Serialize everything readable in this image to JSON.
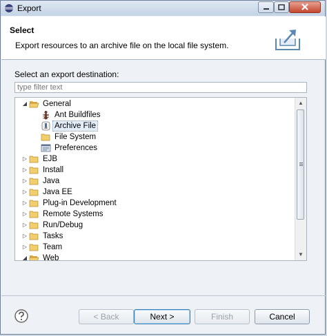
{
  "window": {
    "title": "Export"
  },
  "header": {
    "title": "Select",
    "description": "Export resources to an archive file on the local file system."
  },
  "destination": {
    "label": "Select an export destination:",
    "filter_placeholder": "type filter text"
  },
  "tree": {
    "general": "General",
    "ant_buildfiles": "Ant Buildfiles",
    "archive_file": "Archive File",
    "file_system": "File System",
    "preferences": "Preferences",
    "ejb": "EJB",
    "install": "Install",
    "java": "Java",
    "java_ee": "Java EE",
    "plugin_development": "Plug-in Development",
    "remote_systems": "Remote Systems",
    "run_debug": "Run/Debug",
    "tasks": "Tasks",
    "team": "Team",
    "web": "Web",
    "selected_item": "Archive File"
  },
  "buttons": {
    "back": "< Back",
    "next": "Next >",
    "finish": "Finish",
    "cancel": "Cancel"
  },
  "colors": {
    "accent": "#3c7fb1",
    "folder": "#e8c15a",
    "close_button": "#c5462d"
  }
}
